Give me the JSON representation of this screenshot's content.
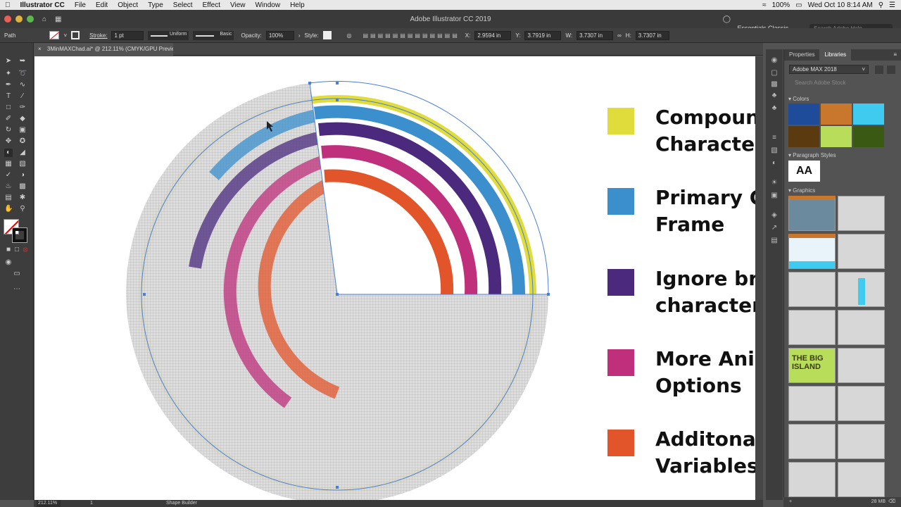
{
  "menubar": {
    "app": "Illustrator CC",
    "items": [
      "File",
      "Edit",
      "Object",
      "Type",
      "Select",
      "Effect",
      "View",
      "Window",
      "Help"
    ],
    "battery": "100%",
    "clock": "Wed Oct 10  8:14 AM"
  },
  "window": {
    "title": "Adobe Illustrator CC 2019",
    "workspace": "Essentials Classic",
    "search_placeholder": "Search Adobe Help"
  },
  "control": {
    "selection": "Path",
    "stroke_label": "Stroke:",
    "stroke_weight": "1 pt",
    "profile": "Uniform",
    "brush": "Basic",
    "opacity_label": "Opacity:",
    "opacity": "100%",
    "style_label": "Style:",
    "x_label": "X:",
    "x": "2.9594 in",
    "y_label": "Y:",
    "y": "3.7919 in",
    "w_label": "W:",
    "w": "3.7307 in",
    "h_label": "H:",
    "h": "3.7307 in"
  },
  "document": {
    "tab": "3MinMAXChad.ai* @ 212.11% (CMYK/GPU Preview)"
  },
  "legend": [
    {
      "line1": "Compoun",
      "line2": "Character",
      "color": "#e0dc3b"
    },
    {
      "line1": "Primary G",
      "line2": "Frame",
      "color": "#3a8fcc"
    },
    {
      "line1": "Ignore bre",
      "line2": "characters",
      "color": "#4b2a7d"
    },
    {
      "line1": "More Anim",
      "line2": "Options",
      "color": "#bf2f7b"
    },
    {
      "line1": "Additonal",
      "line2": "Variables",
      "color": "#e2552a"
    }
  ],
  "panel": {
    "tabs": [
      "Properties",
      "Libraries"
    ],
    "active_tab": "Libraries",
    "library": "Adobe MAX 2018",
    "library_search_placeholder": "Search Adobe Stock",
    "colors_header": "Colors",
    "colors": [
      "#1e4c9a",
      "#c8772d",
      "#3fcaf0",
      "#5a3a0e",
      "#b8dd5a",
      "#3a5a14"
    ],
    "para_header": "Paragraph Styles",
    "para_sample": "AA",
    "graphics_header": "Graphics",
    "graphic_text": [
      "THE BIG ISLAND"
    ],
    "size": "28 MB"
  },
  "status": {
    "zoom": "212.11%",
    "artboard": "1",
    "tool": "Shape Builder"
  }
}
